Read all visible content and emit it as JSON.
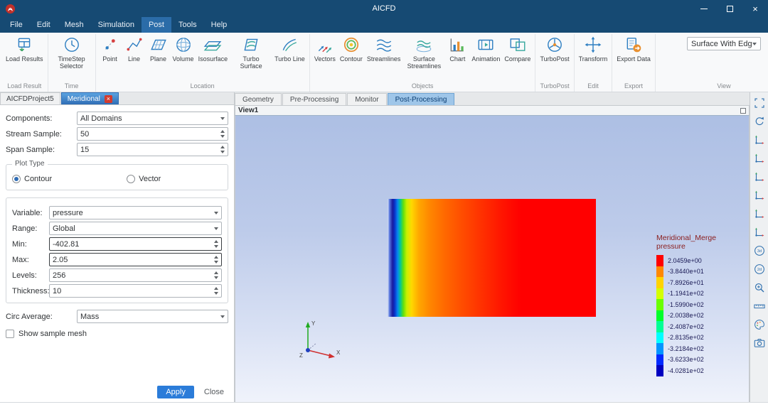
{
  "window": {
    "title": "AICFD"
  },
  "menu": {
    "items": [
      "File",
      "Edit",
      "Mesh",
      "Simulation",
      "Post",
      "Tools",
      "Help"
    ],
    "active": "Post"
  },
  "ribbon": {
    "groups": [
      {
        "label": "Load Result",
        "buttons": [
          {
            "name": "load-results-button",
            "label": "Load Results",
            "icon": "load-results"
          }
        ]
      },
      {
        "label": "Time",
        "buttons": [
          {
            "name": "timestep-selector-button",
            "label": "TimeStep Selector",
            "icon": "timestep"
          }
        ]
      },
      {
        "label": "Location",
        "buttons": [
          {
            "name": "point-button",
            "label": "Point",
            "icon": "point"
          },
          {
            "name": "line-button",
            "label": "Line",
            "icon": "line"
          },
          {
            "name": "plane-button",
            "label": "Plane",
            "icon": "plane"
          },
          {
            "name": "volume-button",
            "label": "Volume",
            "icon": "volume"
          },
          {
            "name": "isosurface-button",
            "label": "Isosurface",
            "icon": "isosurface"
          },
          {
            "name": "turbo-surface-button",
            "label": "Turbo Surface",
            "icon": "turbo-surface"
          },
          {
            "name": "turbo-line-button",
            "label": "Turbo Line",
            "icon": "turbo-line"
          }
        ]
      },
      {
        "label": "Objects",
        "buttons": [
          {
            "name": "vectors-button",
            "label": "Vectors",
            "icon": "vectors"
          },
          {
            "name": "contour-button",
            "label": "Contour",
            "icon": "contour"
          },
          {
            "name": "streamlines-button",
            "label": "Streamlines",
            "icon": "streamlines"
          },
          {
            "name": "surface-streamlines-button",
            "label": "Surface Streamlines",
            "icon": "surface-streamlines"
          },
          {
            "name": "chart-button",
            "label": "Chart",
            "icon": "chart"
          },
          {
            "name": "animation-button",
            "label": "Animation",
            "icon": "animation"
          },
          {
            "name": "compare-button",
            "label": "Compare",
            "icon": "compare"
          }
        ]
      },
      {
        "label": "TurboPost",
        "buttons": [
          {
            "name": "turbopost-button",
            "label": "TurboPost",
            "icon": "turbopost"
          }
        ]
      },
      {
        "label": "Edit",
        "buttons": [
          {
            "name": "transform-button",
            "label": "Transform",
            "icon": "transform"
          }
        ]
      },
      {
        "label": "Export",
        "buttons": [
          {
            "name": "export-data-button",
            "label": "Export Data",
            "icon": "export-data"
          }
        ]
      },
      {
        "label": "View",
        "dropdown": "Surface With Edge"
      }
    ]
  },
  "panel": {
    "tabs": [
      {
        "label": "AICFDProject5",
        "active": false,
        "closable": false
      },
      {
        "label": "Meridional",
        "active": true,
        "closable": true
      }
    ],
    "fields": {
      "components": {
        "label": "Components:",
        "value": "All Domains"
      },
      "stream_sample": {
        "label": "Stream Sample:",
        "value": "50"
      },
      "span_sample": {
        "label": "Span Sample:",
        "value": "15"
      },
      "plot_type": {
        "label": "Plot Type",
        "options": [
          "Contour",
          "Vector"
        ],
        "selected": "Contour"
      },
      "variable": {
        "label": "Variable:",
        "value": "pressure"
      },
      "range": {
        "label": "Range:",
        "value": "Global"
      },
      "min": {
        "label": "Min:",
        "value": "-402.81"
      },
      "max": {
        "label": "Max:",
        "value": "2.05"
      },
      "levels": {
        "label": "Levels:",
        "value": "256"
      },
      "thickness": {
        "label": "Thickness:",
        "value": "10"
      },
      "circ_average": {
        "label": "Circ Average:",
        "value": "Mass"
      },
      "show_sample_mesh": {
        "label": "Show sample mesh",
        "checked": false
      }
    },
    "buttons": {
      "apply": "Apply",
      "close": "Close"
    }
  },
  "main_tabs": [
    {
      "label": "Geometry",
      "active": false
    },
    {
      "label": "Pre-Processing",
      "active": false
    },
    {
      "label": "Monitor",
      "active": false
    },
    {
      "label": "Post-Processing",
      "active": true
    }
  ],
  "viewport": {
    "name": "View1",
    "legend": {
      "title_line1": "Meridional_Merge",
      "title_line2": "pressure",
      "ticks": [
        {
          "label": "2.0459e+00",
          "color": "#ff0000"
        },
        {
          "label": "-3.8440e+01",
          "color": "#ff8800"
        },
        {
          "label": "-7.8926e+01",
          "color": "#ffd300"
        },
        {
          "label": "-1.1941e+02",
          "color": "#d4ff00"
        },
        {
          "label": "-1.5990e+02",
          "color": "#6aff00"
        },
        {
          "label": "-2.0038e+02",
          "color": "#00ff2a"
        },
        {
          "label": "-2.4087e+02",
          "color": "#00ff95"
        },
        {
          "label": "-2.8135e+02",
          "color": "#00ffff"
        },
        {
          "label": "-3.2184e+02",
          "color": "#0095ff"
        },
        {
          "label": "-3.6233e+02",
          "color": "#002aff"
        },
        {
          "label": "-4.0281e+02",
          "color": "#0000c0"
        }
      ]
    }
  },
  "right_toolbar": [
    {
      "name": "fit-view",
      "icon": "fit"
    },
    {
      "name": "refresh-view",
      "icon": "refresh"
    },
    {
      "name": "view-isometric",
      "icon": "axis"
    },
    {
      "name": "view-front",
      "icon": "axis"
    },
    {
      "name": "view-top",
      "icon": "axis"
    },
    {
      "name": "view-left",
      "icon": "axis"
    },
    {
      "name": "view-right",
      "icon": "axis"
    },
    {
      "name": "view-back",
      "icon": "axis"
    },
    {
      "name": "perspective-3d",
      "icon": "persp3d"
    },
    {
      "name": "perspective-2d",
      "icon": "persp2d"
    },
    {
      "name": "zoom-window",
      "icon": "zoom"
    },
    {
      "name": "scale-ruler",
      "icon": "ruler"
    },
    {
      "name": "color-palette",
      "icon": "palette"
    },
    {
      "name": "screenshot-camera",
      "icon": "camera"
    }
  ]
}
